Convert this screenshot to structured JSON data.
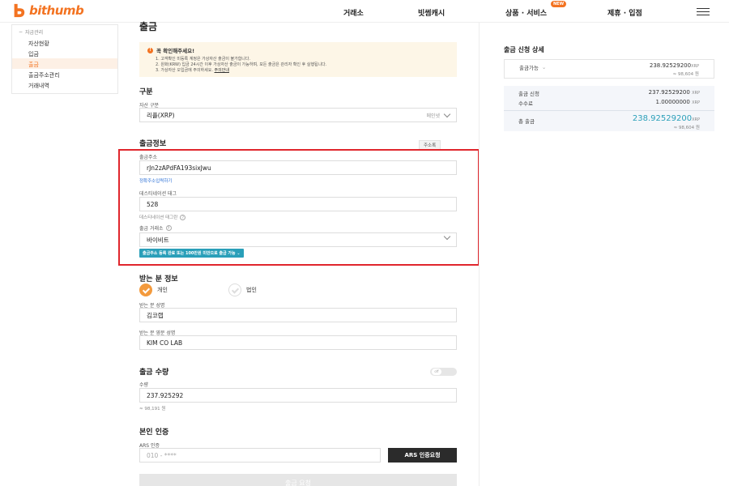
{
  "header": {
    "logo_text": "bithumb",
    "nav": [
      "거래소",
      "빗썸캐시",
      "상품 · 서비스",
      "제휴 · 입점"
    ],
    "nav_badge": "NEW"
  },
  "sidebar": {
    "section": "자금관리",
    "items": [
      {
        "label": "자산현황",
        "active": false
      },
      {
        "label": "입금",
        "active": false
      },
      {
        "label": "출금",
        "active": true
      },
      {
        "label": "출금주소관리",
        "active": false
      },
      {
        "label": "거래내역",
        "active": false
      }
    ]
  },
  "page_title": "출금",
  "notice": {
    "title": "꼭 확인해주세요!",
    "lines": [
      "1. 고객확인 미등록 계정은 가상자산 출금이 불가합니다.",
      "2. 원화(KRW) 입금 24시간 이후 가상자산 출금이 가능하며, 모든 출금은 관리자 확인 후 실행됩니다.",
      "3. 가상자산 오입금에 주의하세요."
    ],
    "link": "주의안내"
  },
  "category": {
    "title": "구분",
    "asset_label": "자산 구분",
    "asset_value": "리플(XRP)",
    "network_label": "메인넷"
  },
  "withdraw_info": {
    "title": "출금정보",
    "address_book_btn": "주소록",
    "address_label": "출금주소",
    "address_value": "rJn2zAPdFA193sixJwu",
    "address_link": "정확주소입력하기",
    "tag_label": "데스티네이션 태그",
    "tag_value": "528",
    "tag_hint": "데스티네이션 태그란",
    "exchange_label": "출금 거래소",
    "exchange_value": "바이비트",
    "exchange_badge": "출금주소 등록 완료 또는 100만원 미만으로 출금 가능"
  },
  "recipient": {
    "title": "받는 분 정보",
    "type_individual": "개인",
    "type_corporate": "법인",
    "name_label": "받는 분 성명",
    "name_value": "김코랩",
    "name_en_label": "받는 분 영문 성명",
    "name_en_value": "KIM CO LAB"
  },
  "amount": {
    "title": "출금 수량",
    "toggle_text": "off",
    "qty_label": "수량",
    "qty_value": "237.925292",
    "krw_equiv": "≈ 98,191 원"
  },
  "verify": {
    "title": "본인 인증",
    "ars_label": "ARS 인증",
    "phone_value": "010 - ****",
    "ars_button": "ARS 인증요청",
    "submit": "출금 요청"
  },
  "summary": {
    "title": "출금 신청 상세",
    "available_label": "출금가능",
    "available_value": "238.92529200",
    "available_unit": "XRP",
    "available_krw": "≈ 98,604 원",
    "request_label": "출금 신청",
    "request_value": "237.92529200",
    "fee_label": "수수료",
    "fee_value": "1.00000000",
    "total_label": "총 출금",
    "total_value": "238.92529200",
    "total_krw": "≈ 98,604 원",
    "unit": "XRP"
  }
}
